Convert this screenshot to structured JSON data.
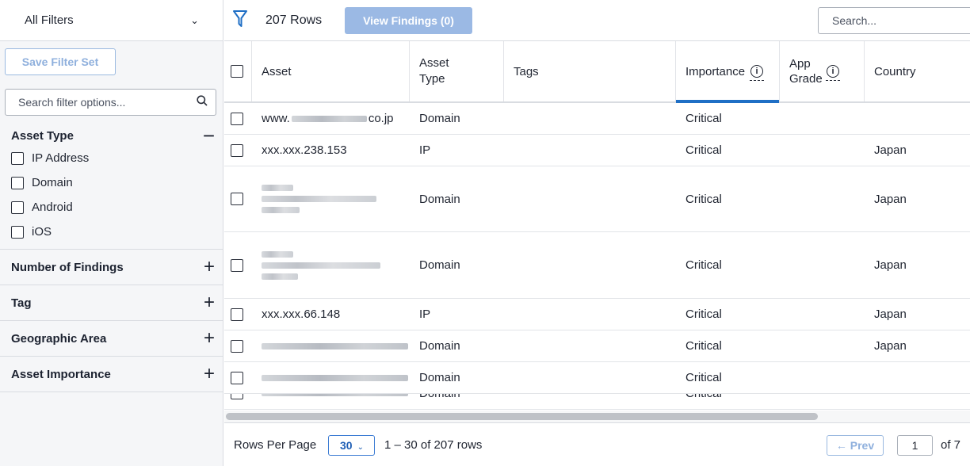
{
  "sidebar": {
    "filter_set": "All Filters",
    "save_label": "Save Filter Set",
    "search_placeholder": "Search filter options...",
    "asset_type": {
      "title": "Asset Type",
      "options": [
        "IP Address",
        "Domain",
        "Android",
        "iOS"
      ]
    },
    "sections": [
      "Number of Findings",
      "Tag",
      "Geographic Area",
      "Asset Importance"
    ]
  },
  "toolbar": {
    "rows_count": "207 Rows",
    "view_findings_label": "View Findings (0)",
    "search_placeholder": "Search..."
  },
  "table": {
    "columns": [
      "Asset",
      "Asset Type",
      "Tags",
      "Importance",
      "App Grade",
      "Country"
    ],
    "rows": [
      {
        "asset_prefix": "www.",
        "asset_suffix": "co.jp",
        "type": "Domain",
        "tags": "",
        "importance": "Critical",
        "app_grade": "",
        "country": ""
      },
      {
        "asset": "xxx.xxx.238.153",
        "type": "IP",
        "tags": "",
        "importance": "Critical",
        "app_grade": "",
        "country": "Japan"
      },
      {
        "asset": "",
        "type": "Domain",
        "tags": "",
        "importance": "Critical",
        "app_grade": "",
        "country": "Japan"
      },
      {
        "asset": "",
        "type": "Domain",
        "tags": "",
        "importance": "Critical",
        "app_grade": "",
        "country": "Japan"
      },
      {
        "asset": "xxx.xxx.66.148",
        "type": "IP",
        "tags": "",
        "importance": "Critical",
        "app_grade": "",
        "country": "Japan"
      },
      {
        "asset": "",
        "type": "Domain",
        "tags": "",
        "importance": "Critical",
        "app_grade": "",
        "country": "Japan"
      },
      {
        "asset": "",
        "type": "Domain",
        "tags": "",
        "importance": "Critical",
        "app_grade": "",
        "country": ""
      },
      {
        "asset": "",
        "type": "Domain",
        "tags": "",
        "importance": "Critical",
        "app_grade": "",
        "country": ""
      }
    ]
  },
  "footer": {
    "rows_per_page_label": "Rows Per Page",
    "rows_per_page_value": "30",
    "range": "1 – 30 of 207 rows",
    "prev_label": "← Prev",
    "page": "1",
    "of_pages": "of 7"
  },
  "colors": {
    "accent": "#1f6fc5",
    "disabled_button": "#9bb9e4"
  }
}
